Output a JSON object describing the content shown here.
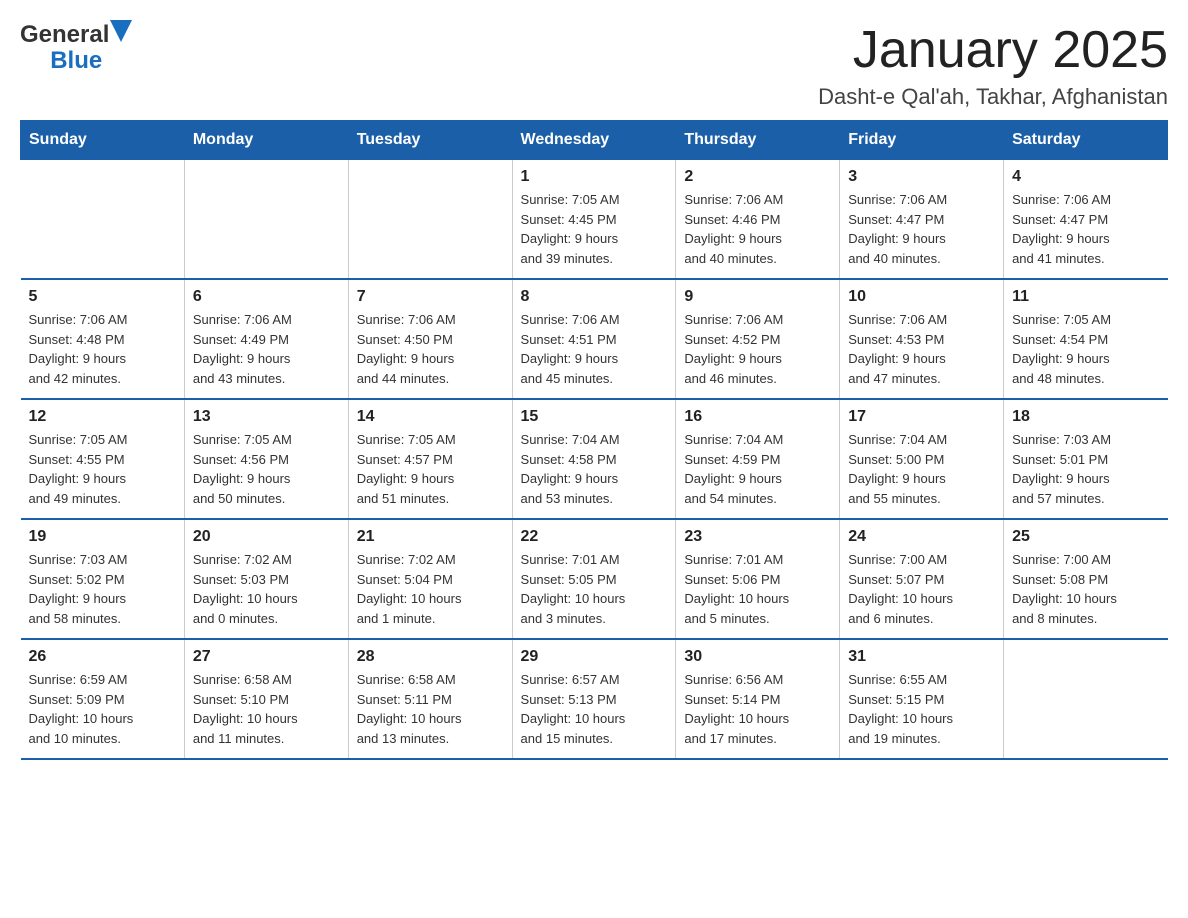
{
  "header": {
    "logo_general": "General",
    "logo_blue": "Blue",
    "title": "January 2025",
    "subtitle": "Dasht-e Qal'ah, Takhar, Afghanistan"
  },
  "days_of_week": [
    "Sunday",
    "Monday",
    "Tuesday",
    "Wednesday",
    "Thursday",
    "Friday",
    "Saturday"
  ],
  "weeks": [
    [
      {
        "day": "",
        "info": ""
      },
      {
        "day": "",
        "info": ""
      },
      {
        "day": "",
        "info": ""
      },
      {
        "day": "1",
        "info": "Sunrise: 7:05 AM\nSunset: 4:45 PM\nDaylight: 9 hours\nand 39 minutes."
      },
      {
        "day": "2",
        "info": "Sunrise: 7:06 AM\nSunset: 4:46 PM\nDaylight: 9 hours\nand 40 minutes."
      },
      {
        "day": "3",
        "info": "Sunrise: 7:06 AM\nSunset: 4:47 PM\nDaylight: 9 hours\nand 40 minutes."
      },
      {
        "day": "4",
        "info": "Sunrise: 7:06 AM\nSunset: 4:47 PM\nDaylight: 9 hours\nand 41 minutes."
      }
    ],
    [
      {
        "day": "5",
        "info": "Sunrise: 7:06 AM\nSunset: 4:48 PM\nDaylight: 9 hours\nand 42 minutes."
      },
      {
        "day": "6",
        "info": "Sunrise: 7:06 AM\nSunset: 4:49 PM\nDaylight: 9 hours\nand 43 minutes."
      },
      {
        "day": "7",
        "info": "Sunrise: 7:06 AM\nSunset: 4:50 PM\nDaylight: 9 hours\nand 44 minutes."
      },
      {
        "day": "8",
        "info": "Sunrise: 7:06 AM\nSunset: 4:51 PM\nDaylight: 9 hours\nand 45 minutes."
      },
      {
        "day": "9",
        "info": "Sunrise: 7:06 AM\nSunset: 4:52 PM\nDaylight: 9 hours\nand 46 minutes."
      },
      {
        "day": "10",
        "info": "Sunrise: 7:06 AM\nSunset: 4:53 PM\nDaylight: 9 hours\nand 47 minutes."
      },
      {
        "day": "11",
        "info": "Sunrise: 7:05 AM\nSunset: 4:54 PM\nDaylight: 9 hours\nand 48 minutes."
      }
    ],
    [
      {
        "day": "12",
        "info": "Sunrise: 7:05 AM\nSunset: 4:55 PM\nDaylight: 9 hours\nand 49 minutes."
      },
      {
        "day": "13",
        "info": "Sunrise: 7:05 AM\nSunset: 4:56 PM\nDaylight: 9 hours\nand 50 minutes."
      },
      {
        "day": "14",
        "info": "Sunrise: 7:05 AM\nSunset: 4:57 PM\nDaylight: 9 hours\nand 51 minutes."
      },
      {
        "day": "15",
        "info": "Sunrise: 7:04 AM\nSunset: 4:58 PM\nDaylight: 9 hours\nand 53 minutes."
      },
      {
        "day": "16",
        "info": "Sunrise: 7:04 AM\nSunset: 4:59 PM\nDaylight: 9 hours\nand 54 minutes."
      },
      {
        "day": "17",
        "info": "Sunrise: 7:04 AM\nSunset: 5:00 PM\nDaylight: 9 hours\nand 55 minutes."
      },
      {
        "day": "18",
        "info": "Sunrise: 7:03 AM\nSunset: 5:01 PM\nDaylight: 9 hours\nand 57 minutes."
      }
    ],
    [
      {
        "day": "19",
        "info": "Sunrise: 7:03 AM\nSunset: 5:02 PM\nDaylight: 9 hours\nand 58 minutes."
      },
      {
        "day": "20",
        "info": "Sunrise: 7:02 AM\nSunset: 5:03 PM\nDaylight: 10 hours\nand 0 minutes."
      },
      {
        "day": "21",
        "info": "Sunrise: 7:02 AM\nSunset: 5:04 PM\nDaylight: 10 hours\nand 1 minute."
      },
      {
        "day": "22",
        "info": "Sunrise: 7:01 AM\nSunset: 5:05 PM\nDaylight: 10 hours\nand 3 minutes."
      },
      {
        "day": "23",
        "info": "Sunrise: 7:01 AM\nSunset: 5:06 PM\nDaylight: 10 hours\nand 5 minutes."
      },
      {
        "day": "24",
        "info": "Sunrise: 7:00 AM\nSunset: 5:07 PM\nDaylight: 10 hours\nand 6 minutes."
      },
      {
        "day": "25",
        "info": "Sunrise: 7:00 AM\nSunset: 5:08 PM\nDaylight: 10 hours\nand 8 minutes."
      }
    ],
    [
      {
        "day": "26",
        "info": "Sunrise: 6:59 AM\nSunset: 5:09 PM\nDaylight: 10 hours\nand 10 minutes."
      },
      {
        "day": "27",
        "info": "Sunrise: 6:58 AM\nSunset: 5:10 PM\nDaylight: 10 hours\nand 11 minutes."
      },
      {
        "day": "28",
        "info": "Sunrise: 6:58 AM\nSunset: 5:11 PM\nDaylight: 10 hours\nand 13 minutes."
      },
      {
        "day": "29",
        "info": "Sunrise: 6:57 AM\nSunset: 5:13 PM\nDaylight: 10 hours\nand 15 minutes."
      },
      {
        "day": "30",
        "info": "Sunrise: 6:56 AM\nSunset: 5:14 PM\nDaylight: 10 hours\nand 17 minutes."
      },
      {
        "day": "31",
        "info": "Sunrise: 6:55 AM\nSunset: 5:15 PM\nDaylight: 10 hours\nand 19 minutes."
      },
      {
        "day": "",
        "info": ""
      }
    ]
  ]
}
